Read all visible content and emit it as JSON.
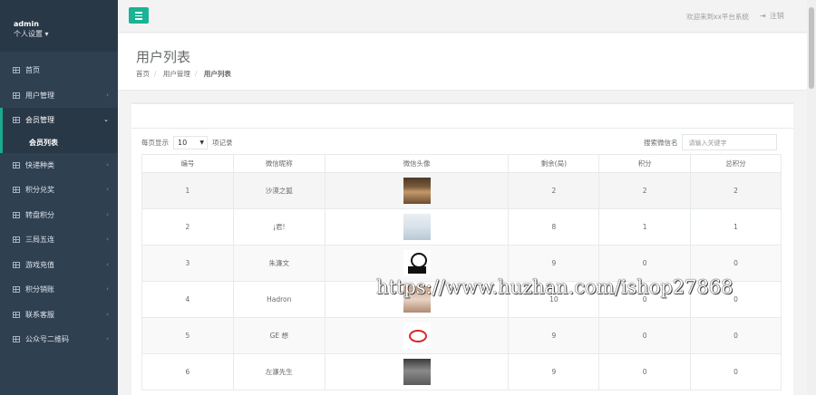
{
  "sidebar": {
    "username": "admin",
    "profile_menu": "个人设置",
    "items": [
      {
        "label": "首页"
      },
      {
        "label": "用户管理",
        "arrow": "‹"
      },
      {
        "label": "会员管理",
        "arrow": "⌄"
      },
      {
        "label": "快递种类",
        "arrow": "‹"
      },
      {
        "label": "积分兑奖",
        "arrow": "‹"
      },
      {
        "label": "转盘积分",
        "arrow": "‹"
      },
      {
        "label": "三局五连",
        "arrow": "‹"
      },
      {
        "label": "游戏充值",
        "arrow": "‹"
      },
      {
        "label": "积分销账",
        "arrow": "‹"
      },
      {
        "label": "联系客服",
        "arrow": "‹"
      },
      {
        "label": "公众号二维码",
        "arrow": "‹"
      }
    ],
    "submenu_active": "会员列表"
  },
  "topbar": {
    "welcome": "欢迎来到xx平台系统",
    "logout": "注销"
  },
  "page": {
    "title": "用户列表",
    "breadcrumb": [
      "首页",
      "用户管理",
      "用户列表"
    ]
  },
  "table_controls": {
    "length_prefix": "每页显示",
    "length_value": "10",
    "length_suffix": "项记录",
    "search_label": "搜索微信名",
    "search_placeholder": "请输入关键字"
  },
  "table": {
    "headers": [
      "编号",
      "微信昵称",
      "微信头像",
      "剩余(局)",
      "积分",
      "总积分"
    ],
    "rows": [
      {
        "id": "1",
        "nickname": "沙漠之狐",
        "remaining": "2",
        "points": "2",
        "total": "2"
      },
      {
        "id": "2",
        "nickname": "¡君!",
        "remaining": "8",
        "points": "1",
        "total": "1"
      },
      {
        "id": "3",
        "nickname": "朱濂文",
        "remaining": "9",
        "points": "0",
        "total": "0"
      },
      {
        "id": "4",
        "nickname": "Hadron",
        "remaining": "10",
        "points": "0",
        "total": "0"
      },
      {
        "id": "5",
        "nickname": "GE 想",
        "remaining": "9",
        "points": "0",
        "total": "0"
      },
      {
        "id": "6",
        "nickname": "左濂先生",
        "remaining": "9",
        "points": "0",
        "total": "0"
      }
    ]
  },
  "watermark": "https://www.huzhan.com/ishop27868",
  "colors": {
    "sidebar_bg": "#2f4050",
    "accent": "#1ab394"
  }
}
